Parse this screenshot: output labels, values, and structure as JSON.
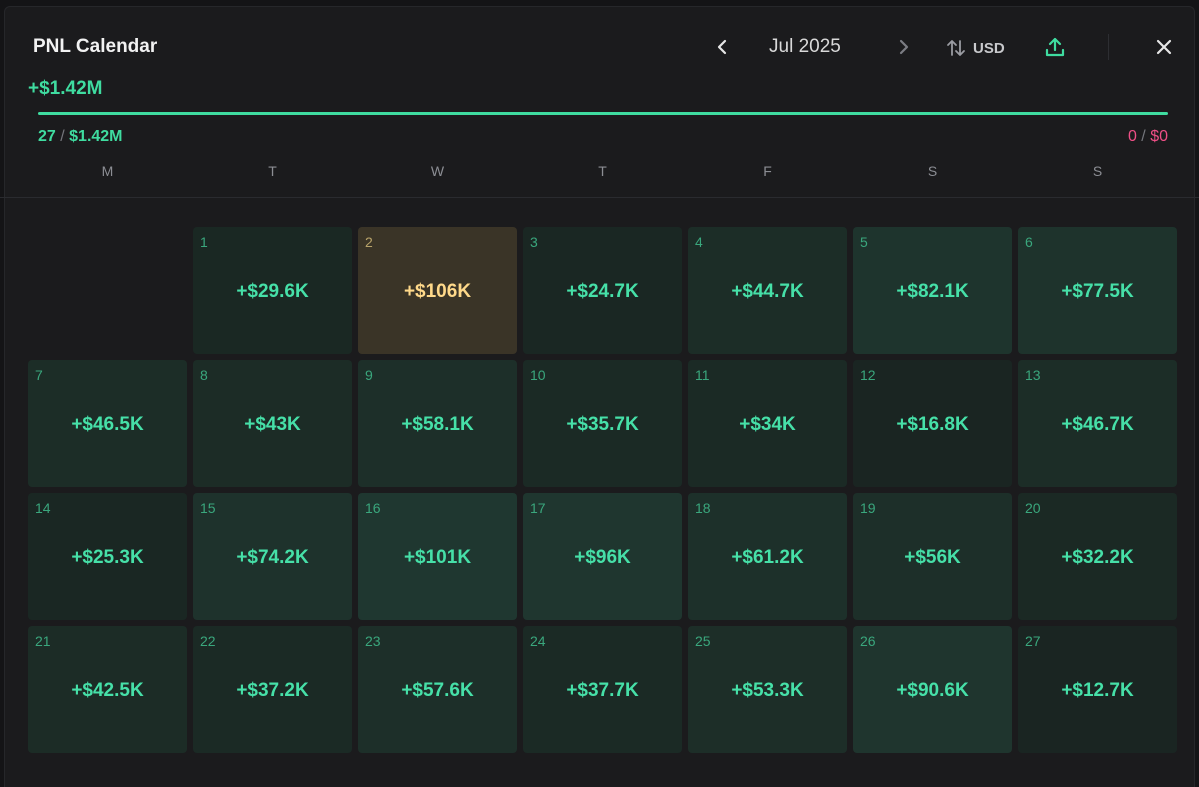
{
  "header": {
    "title": "PNL Calendar",
    "month": "Jul 2025",
    "currency": "USD"
  },
  "summary": {
    "total": "+$1.42M",
    "win_days": "27",
    "win_amount": "$1.42M",
    "loss_days": "0",
    "loss_amount": "$0",
    "win_fraction": 1.0,
    "colors": {
      "profit": "#3fdca0",
      "loss": "#ef4f86",
      "best_day": "#ffd98a"
    }
  },
  "weekdays": [
    "M",
    "T",
    "W",
    "T",
    "F",
    "S",
    "S"
  ],
  "days": [
    {
      "day": "1",
      "pnl": "+$29.6K",
      "bg": "#1a2823"
    },
    {
      "day": "2",
      "pnl": "+$106K",
      "bg": "#3a3427",
      "best": true
    },
    {
      "day": "3",
      "pnl": "+$24.7K",
      "bg": "#1a2723"
    },
    {
      "day": "4",
      "pnl": "+$44.7K",
      "bg": "#1c2d27"
    },
    {
      "day": "5",
      "pnl": "+$82.1K",
      "bg": "#1e342d"
    },
    {
      "day": "6",
      "pnl": "+$77.5K",
      "bg": "#1e332c"
    },
    {
      "day": "7",
      "pnl": "+$46.5K",
      "bg": "#1c2d27"
    },
    {
      "day": "8",
      "pnl": "+$43K",
      "bg": "#1c2c26"
    },
    {
      "day": "9",
      "pnl": "+$58.1K",
      "bg": "#1d2f29"
    },
    {
      "day": "10",
      "pnl": "+$35.7K",
      "bg": "#1b2a25"
    },
    {
      "day": "11",
      "pnl": "+$34K",
      "bg": "#1b2a25"
    },
    {
      "day": "12",
      "pnl": "+$16.8K",
      "bg": "#1a2522"
    },
    {
      "day": "13",
      "pnl": "+$46.7K",
      "bg": "#1c2d27"
    },
    {
      "day": "14",
      "pnl": "+$25.3K",
      "bg": "#1a2723"
    },
    {
      "day": "15",
      "pnl": "+$74.2K",
      "bg": "#1e322c"
    },
    {
      "day": "16",
      "pnl": "+$101K",
      "bg": "#1f3730"
    },
    {
      "day": "17",
      "pnl": "+$96K",
      "bg": "#1f362f"
    },
    {
      "day": "18",
      "pnl": "+$61.2K",
      "bg": "#1d302a"
    },
    {
      "day": "19",
      "pnl": "+$56K",
      "bg": "#1d2f29"
    },
    {
      "day": "20",
      "pnl": "+$32.2K",
      "bg": "#1b2924"
    },
    {
      "day": "21",
      "pnl": "+$42.5K",
      "bg": "#1c2c26"
    },
    {
      "day": "22",
      "pnl": "+$37.2K",
      "bg": "#1b2a25"
    },
    {
      "day": "23",
      "pnl": "+$57.6K",
      "bg": "#1d2f29"
    },
    {
      "day": "24",
      "pnl": "+$37.7K",
      "bg": "#1b2a25"
    },
    {
      "day": "25",
      "pnl": "+$53.3K",
      "bg": "#1d2e28"
    },
    {
      "day": "26",
      "pnl": "+$90.6K",
      "bg": "#1f352e"
    },
    {
      "day": "27",
      "pnl": "+$12.7K",
      "bg": "#1a2522"
    }
  ]
}
